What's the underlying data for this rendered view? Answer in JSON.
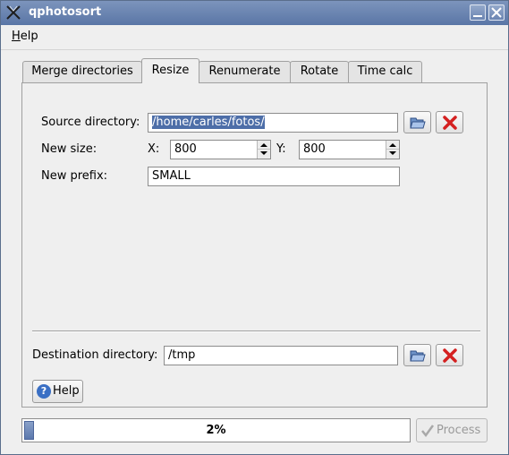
{
  "window": {
    "title": "qphotosort",
    "app_icon": "app-icon",
    "buttons": [
      "minimize-icon",
      "close-icon"
    ]
  },
  "menu": {
    "help_label": "Help",
    "help_mnemonic": "H",
    "help_rest": "elp"
  },
  "tabs": [
    {
      "label": "Merge directories",
      "active": false
    },
    {
      "label": "Resize",
      "active": true
    },
    {
      "label": "Renumerate",
      "active": false
    },
    {
      "label": "Rotate",
      "active": false
    },
    {
      "label": "Time calc",
      "active": false
    }
  ],
  "resize": {
    "source_label": "Source directory:",
    "source_value": "/home/carles/fotos/",
    "new_size_label": "New size:",
    "x_label": "X:",
    "x_value": "800",
    "y_label": "Y:",
    "y_value": "800",
    "prefix_label": "New prefix:",
    "prefix_value": "SMALL",
    "browse_icon": "open-folder-icon",
    "clear_icon": "red-x-icon"
  },
  "destination": {
    "label": "Destination directory:",
    "value": "/tmp"
  },
  "help_button": {
    "label": "Help",
    "icon": "question-icon"
  },
  "progress": {
    "percent": 2,
    "text": "2%"
  },
  "process_button": {
    "label": "Process",
    "enabled": false,
    "icon": "check-icon"
  },
  "colors": {
    "titlebar": "#6a84b0",
    "selection": "#4d6ea8",
    "progress_fill": "#5b78ad",
    "clear_red": "#d42020"
  }
}
